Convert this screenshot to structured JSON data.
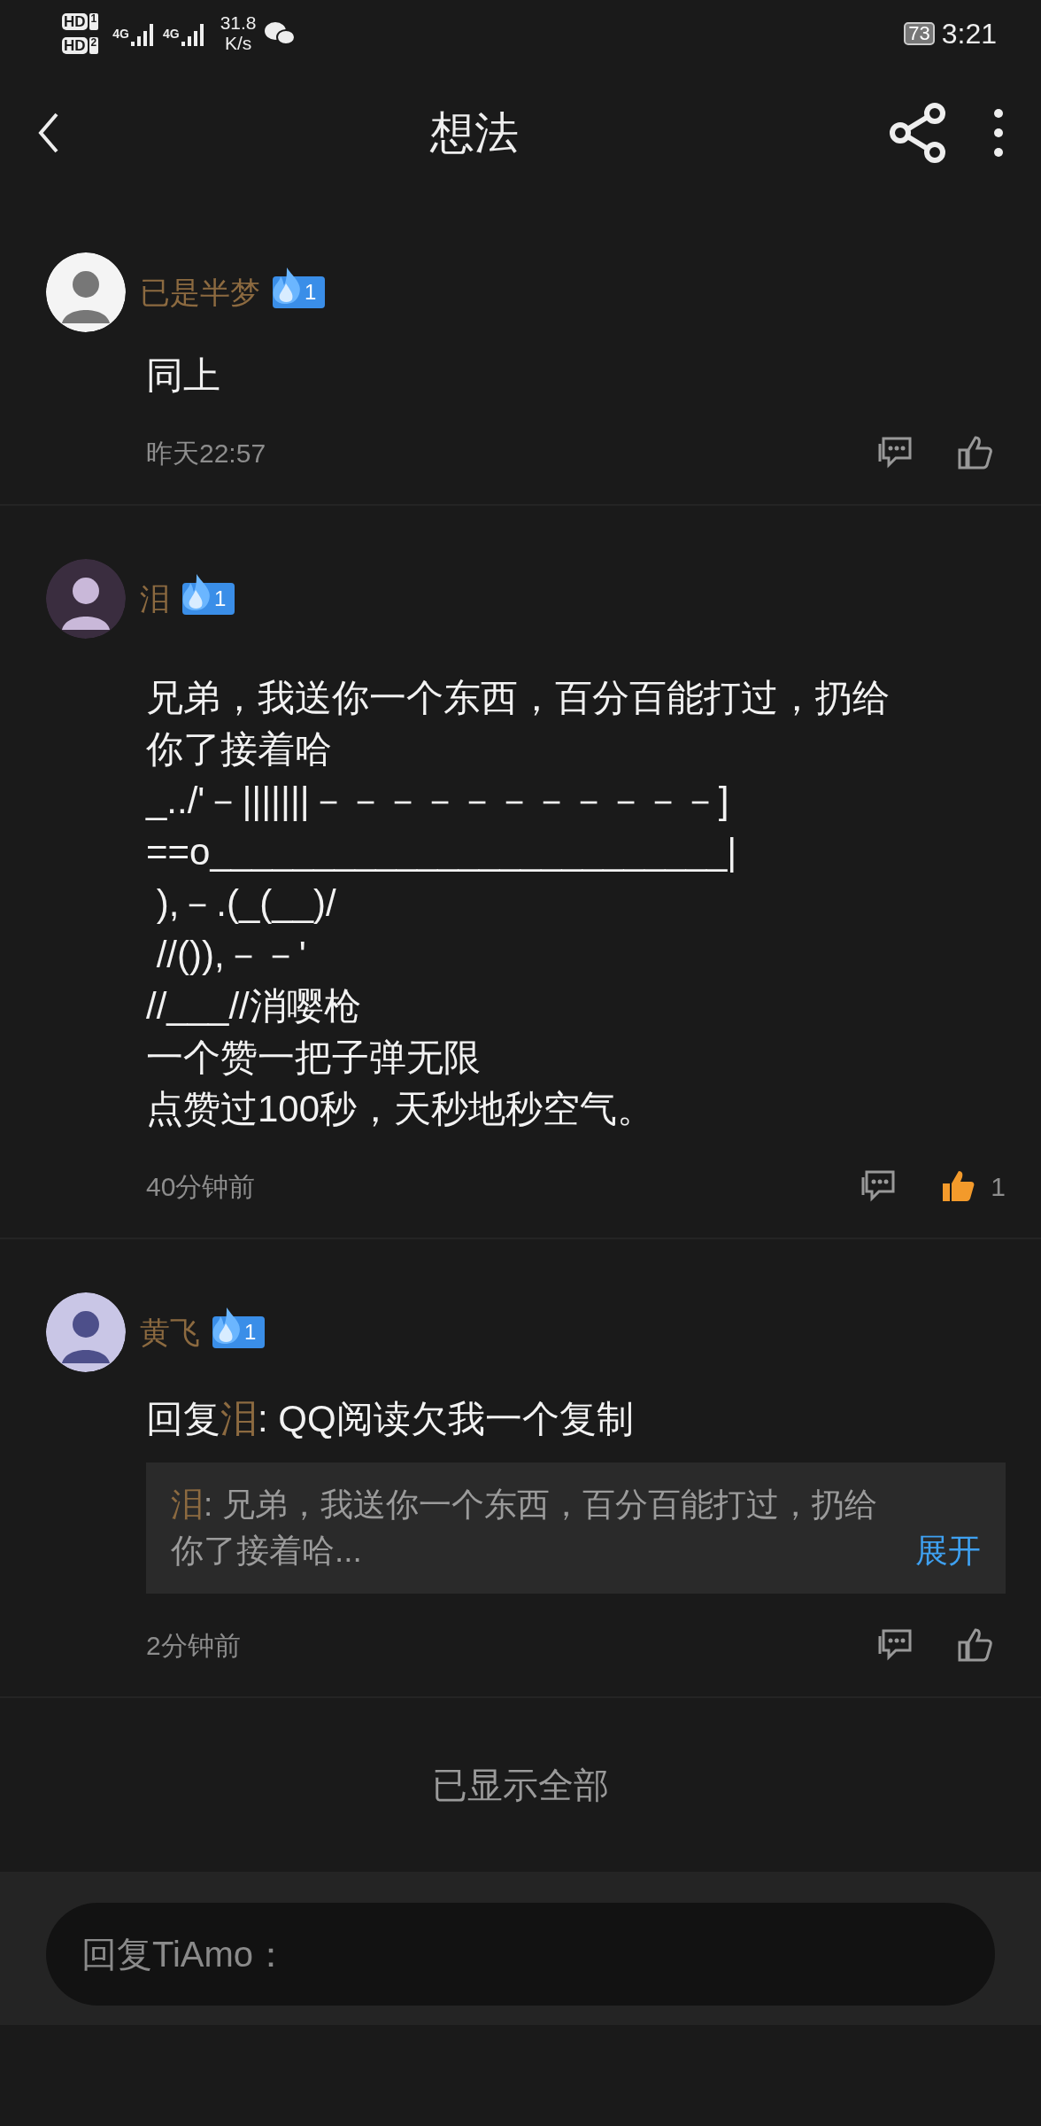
{
  "status_bar": {
    "sims": [
      {
        "label": "HD",
        "slot": "1"
      },
      {
        "label": "HD",
        "slot": "2"
      }
    ],
    "networks": [
      "4G",
      "4G"
    ],
    "speed": "31.8",
    "speed_unit": "K/s",
    "battery": "73",
    "time": "3:21"
  },
  "header": {
    "title": "想法"
  },
  "posts": [
    {
      "kind": "text",
      "author": "已是半梦",
      "badge": "1",
      "lines": [
        "同上"
      ],
      "time": "昨天22:57",
      "liked": false
    },
    {
      "kind": "text",
      "author": "泪",
      "badge": "1",
      "lines": [
        "兄弟，我送你一个东西，百分百能打过，扔给你了接着哈",
        "_../'－|||||||－－－－－－－－－－－]",
        "==o_________________________|",
        " ),－.(_(__)/",
        " //()),－－'",
        "//___//消嘤枪",
        "一个赞一把子弹无限",
        "点赞过100秒，天秒地秒空气。"
      ],
      "time": "40分钟前",
      "liked": true,
      "like_count": "1"
    },
    {
      "kind": "reply",
      "author": "黄飞",
      "badge": "1",
      "reply_prefix": "回复",
      "reply_to": "泪",
      "reply_text": ": QQ阅读欠我一个复制",
      "quote": {
        "author": "泪",
        "text": ": 兄弟，我送你一个东西，百分百能打过，扔给你了接着哈...",
        "expand": "展开"
      },
      "time": "2分钟前",
      "liked": false
    }
  ],
  "end_note": "已显示全部",
  "reply_field": {
    "placeholder": "回复TiAmo："
  }
}
